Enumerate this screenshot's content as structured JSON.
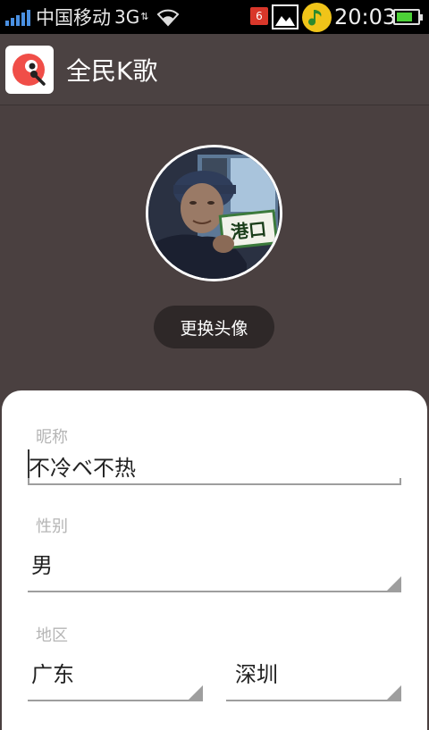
{
  "status_bar": {
    "carrier": "中国移动",
    "network": "3G",
    "notification_count": "6",
    "time": "20:03"
  },
  "app": {
    "title": "全民K歌"
  },
  "profile": {
    "avatar_sign_text": "港口",
    "change_avatar_label": "更换头像"
  },
  "form": {
    "nickname": {
      "label": "昵称",
      "value": "不冷ベ不热"
    },
    "gender": {
      "label": "性别",
      "value": "男"
    },
    "region": {
      "label": "地区",
      "province": "广东",
      "city": "深圳"
    }
  }
}
